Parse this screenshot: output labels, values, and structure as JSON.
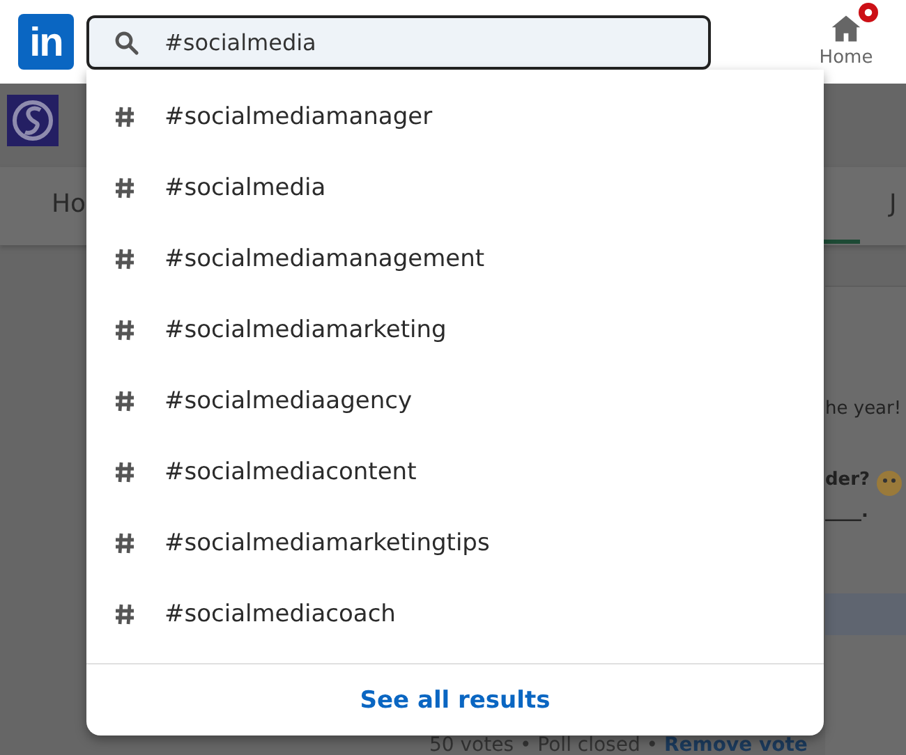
{
  "header": {
    "logo": "in",
    "search": {
      "value": "#socialmedia"
    },
    "home": {
      "label": "Home",
      "notification": true
    }
  },
  "suggestions": [
    {
      "label": "#socialmediamanager"
    },
    {
      "label": "#socialmedia"
    },
    {
      "label": "#socialmediamanagement"
    },
    {
      "label": "#socialmediamarketing"
    },
    {
      "label": "#socialmediaagency"
    },
    {
      "label": "#socialmediacontent"
    },
    {
      "label": "#socialmediamarketingtips"
    },
    {
      "label": "#socialmediacoach"
    }
  ],
  "see_all": "See all results",
  "background": {
    "tabs": [
      "Ho",
      "J"
    ],
    "post_lines": [
      "he year!",
      "der?",
      "____."
    ],
    "poll_footer": {
      "text": "50 votes • Poll closed •",
      "link": "Remove vote"
    }
  }
}
